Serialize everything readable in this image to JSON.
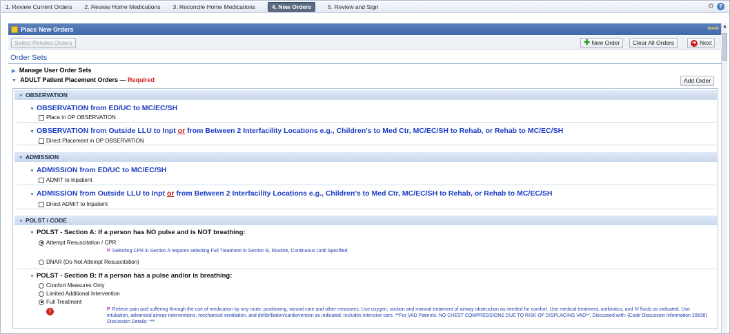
{
  "steps": [
    {
      "label": "1. Review Current Orders",
      "active": false
    },
    {
      "label": "2. Review Home Medications",
      "active": false
    },
    {
      "label": "3. Reconcile Home Medications",
      "active": false
    },
    {
      "label": "4. New Orders",
      "active": true
    },
    {
      "label": "5. Review and Sign",
      "active": false
    }
  ],
  "header": {
    "title": "Place New Orders"
  },
  "toolbar": {
    "select_pended": "Select Pended Orders",
    "new_order": "New Order",
    "clear_all": "Clear All Orders",
    "next": "Next"
  },
  "order_sets": {
    "title": "Order Sets",
    "manage": "Manage User Order Sets",
    "adult_label": "ADULT Patient Placement Orders —",
    "required": "Required",
    "add_order": "Add Order"
  },
  "sections": {
    "observation": "OBSERVATION",
    "admission": "ADMISSION",
    "polst": "POLST / CODE"
  },
  "observation": {
    "item1_title": "OBSERVATION from ED/UC to MC/EC/SH",
    "item1_cb": "Place in OP OBSERVATION",
    "item2_title_a": "OBSERVATION from Outside LLU to Inpt",
    "item2_or": "or",
    "item2_title_b": "from Between 2 Interfacility Locations e.g., Children's to Med Ctr, MC/EC/SH to Rehab, or Rehab to MC/EC/SH",
    "item2_cb": "Direct Placement in OP OBSERVATION"
  },
  "admission": {
    "item1_title": "ADMISSION from ED/UC to MC/EC/SH",
    "item1_cb": "ADMIT to Inpatient",
    "item2_title_a": "ADMISSION from Outside LLU to Inpt",
    "item2_or": "or",
    "item2_title_b": "from Between 2 Interfacility Locations e.g., Children's to Med Ctr, MC/EC/SH to Rehab, or Rehab to MC/EC/SH",
    "item2_cb": "Direct ADMIT to Inpatient"
  },
  "polst": {
    "a_title": "POLST - Section A: If a person has NO pulse and is NOT breathing:",
    "a_opt1": "Attempt Resuscitation / CPR",
    "a_note": "Selecting CPR in Section A requires selecting Full Treatment in Section B, Routine, Continuous Until Specified",
    "a_opt2": "DNAR (Do Not Attempt Resuscitation)",
    "b_title": "POLST - Section B: If a person has a pulse and/or is breathing:",
    "b_opt1": "Comfort Measures Only",
    "b_opt2": "Limited Additional Intervention",
    "b_opt3": "Full Treatment",
    "b_note": "Relieve pain and suffering through the use of medication by any route, positioning, wound care and other measures. Use oxygen, suction and manual treatment of airway obstruction as needed for comfort. Use medical treatment, antibiotics, and IV fluids as indicated. Use intubation, advanced airway interventions, mechanical ventilation, and defibrillation/cardioversion as indicated. Includes intensive care. **For VAD Patients: NO CHEST COMPRESSIONS DUE TO RISK OF DISPLACING VAD**, Discussed with: {Code Discussion Information 20838} Discussion Details: ***"
  }
}
